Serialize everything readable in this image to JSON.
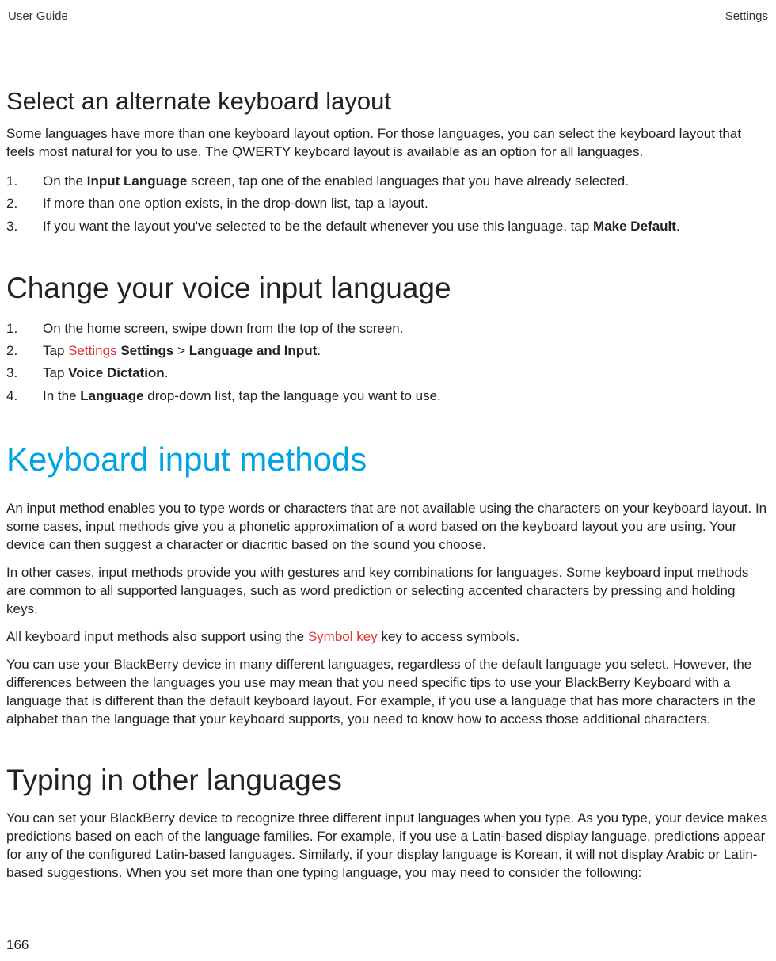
{
  "header": {
    "left": "User Guide",
    "right": "Settings"
  },
  "section1": {
    "title": "Select an alternate keyboard layout",
    "intro": "Some languages have more than one keyboard layout option. For those languages, you can select the keyboard layout that feels most natural for you to use. The QWERTY keyboard layout is available as an option for all languages.",
    "steps": [
      {
        "pre": "On the ",
        "bold1": "Input Language",
        "post": " screen, tap one of the enabled languages that you have already selected."
      },
      {
        "pre": "If more than one option exists, in the drop-down list, tap a layout."
      },
      {
        "pre": "If you want the layout you've selected to be the default whenever you use this language, tap ",
        "bold1": "Make Default",
        "post": "."
      }
    ]
  },
  "section2": {
    "title": "Change your voice input language",
    "steps": [
      {
        "pre": "On the home screen, swipe down from the top of the screen."
      },
      {
        "pre": "Tap  ",
        "icon": "Settings",
        "mid": "  ",
        "bold1": "Settings",
        "mid2": " > ",
        "bold2": "Language and Input",
        "post": "."
      },
      {
        "pre": "Tap ",
        "bold1": "Voice Dictation",
        "post": "."
      },
      {
        "pre": "In the ",
        "bold1": "Language",
        "post": " drop-down list, tap the language you want to use."
      }
    ]
  },
  "section3": {
    "title": "Keyboard input methods",
    "p1": "An input method enables you to type words or characters that are not available using the characters on your keyboard layout. In some cases, input methods give you a phonetic approximation of a word based on the keyboard layout you are using. Your device can then suggest a character or diacritic based on the sound you choose.",
    "p2": "In other cases, input methods provide you with gestures and key combinations for languages. Some keyboard input methods are common to all supported languages, such as word prediction or selecting accented characters by pressing and holding keys.",
    "p3_pre": "All keyboard input methods also support using the  ",
    "p3_key": "Symbol key",
    "p3_post": "  key to access symbols.",
    "p4": "You can use your BlackBerry device in many different languages, regardless of the default language you select. However, the differences between the languages you use may mean that you need specific tips to use your BlackBerry Keyboard with a language that is different than the default keyboard layout. For example, if you use a language that has more characters in the alphabet than the language that your keyboard supports, you need to know how to access those additional characters."
  },
  "section4": {
    "title": "Typing in other languages",
    "p1": "You can set your BlackBerry device to recognize three different input languages when you type. As you type, your device makes predictions based on each of the language families. For example, if you use a Latin-based display language, predictions appear for any of the configured Latin-based languages. Similarly, if your display language is Korean, it will not display Arabic or Latin-based suggestions. When you set more than one typing language, you may need to consider the following:"
  },
  "pageNumber": "166"
}
